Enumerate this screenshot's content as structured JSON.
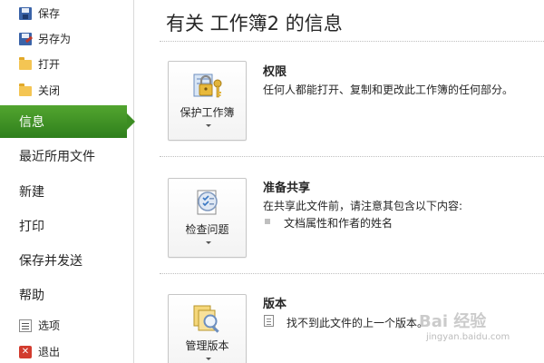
{
  "nav": {
    "save": "保存",
    "save_as": "另存为",
    "open": "打开",
    "close": "关闭",
    "info": "信息",
    "recent": "最近所用文件",
    "new": "新建",
    "print": "打印",
    "save_send": "保存并发送",
    "help": "帮助",
    "options": "选项",
    "exit": "退出"
  },
  "main": {
    "title": "有关 工作簿2 的信息",
    "permissions": {
      "button_label": "保护工作簿",
      "heading": "权限",
      "text": "任何人都能打开、复制和更改此工作簿的任何部分。"
    },
    "prepare": {
      "button_label": "检查问题",
      "heading": "准备共享",
      "text": "在共享此文件前，请注意其包含以下内容:",
      "bullet": "文档属性和作者的姓名"
    },
    "versions": {
      "button_label": "管理版本",
      "heading": "版本",
      "text": "找不到此文件的上一个版本。"
    }
  },
  "watermark": {
    "brand": "Bai 经验",
    "url": "jingyan.baidu.com"
  },
  "colors": {
    "accent_green": "#3c8d22",
    "exit_red": "#d23b2e"
  }
}
